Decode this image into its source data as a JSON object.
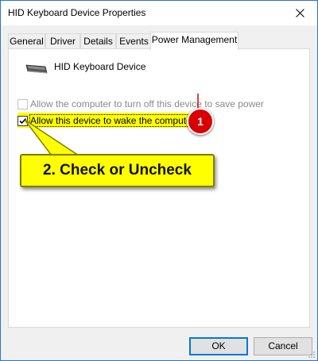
{
  "window": {
    "title": "HID Keyboard Device Properties"
  },
  "tabs": [
    {
      "label": "General",
      "active": false
    },
    {
      "label": "Driver",
      "active": false
    },
    {
      "label": "Details",
      "active": false
    },
    {
      "label": "Events",
      "active": false
    },
    {
      "label": "Power Management",
      "active": true
    }
  ],
  "device": {
    "name": "HID Keyboard Device",
    "icon": "keyboard-icon"
  },
  "options": [
    {
      "label": "Allow the computer to turn off this device to save power",
      "checked": false,
      "enabled": false
    },
    {
      "label": "Allow this device to wake the computer",
      "checked": true,
      "enabled": true
    }
  ],
  "annotations": {
    "badge": "1",
    "callout": "2. Check or Uncheck",
    "highlight_color": "#ffff00",
    "badge_color": "#d80000"
  },
  "buttons": {
    "ok": "OK",
    "cancel": "Cancel"
  },
  "colors": {
    "window_border": "#2b74c9",
    "default_button_border": "#0078d7"
  }
}
